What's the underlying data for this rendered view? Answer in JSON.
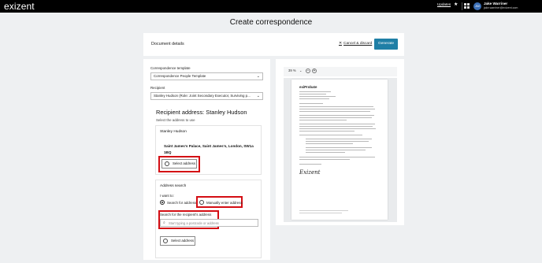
{
  "topbar": {
    "logo": "exizent",
    "updates_label": "Updates",
    "user_name": "Jake Warriner",
    "user_email": "jake.warriner@exizent.com",
    "avatar_initials": "JW",
    "icons": {
      "star": "star-icon",
      "apps": "apps-grid-icon"
    }
  },
  "page": {
    "title": "Create correspondence"
  },
  "header": {
    "title": "Document details",
    "cancel_label": "Cancel & discard",
    "generate_label": "Generate"
  },
  "form": {
    "template_label": "Correspondence template",
    "template_value": "Correspondence People Template",
    "recipient_label": "Recipient",
    "recipient_value": "Stanley Hudson (Role: Joint Secondary Executor, Surviving p...",
    "recipient_address_title": "Recipient address: Stanley Hudson",
    "select_address_hint": "Select the address to use",
    "saved_address": {
      "name": "Stanley Hudson",
      "address": "Saint James's Palace, Saint James's, London, SW1a 1BQ",
      "select_label": "Select address"
    },
    "address_search": {
      "title": "Address search",
      "i_want_to": "I want to:",
      "option_search": "Search for address",
      "option_manual": "Manually enter address",
      "search_label": "Search for the recipient's address",
      "search_placeholder": "Start typing a postcode or address",
      "select_label": "Select address"
    }
  },
  "preview": {
    "zoom_value": "39 %",
    "logo_text": "exiProbate",
    "signature": "Exizent"
  },
  "colors": {
    "accent": "#1f7fa6",
    "highlight": "#d40e14",
    "topbar": "#000000"
  }
}
